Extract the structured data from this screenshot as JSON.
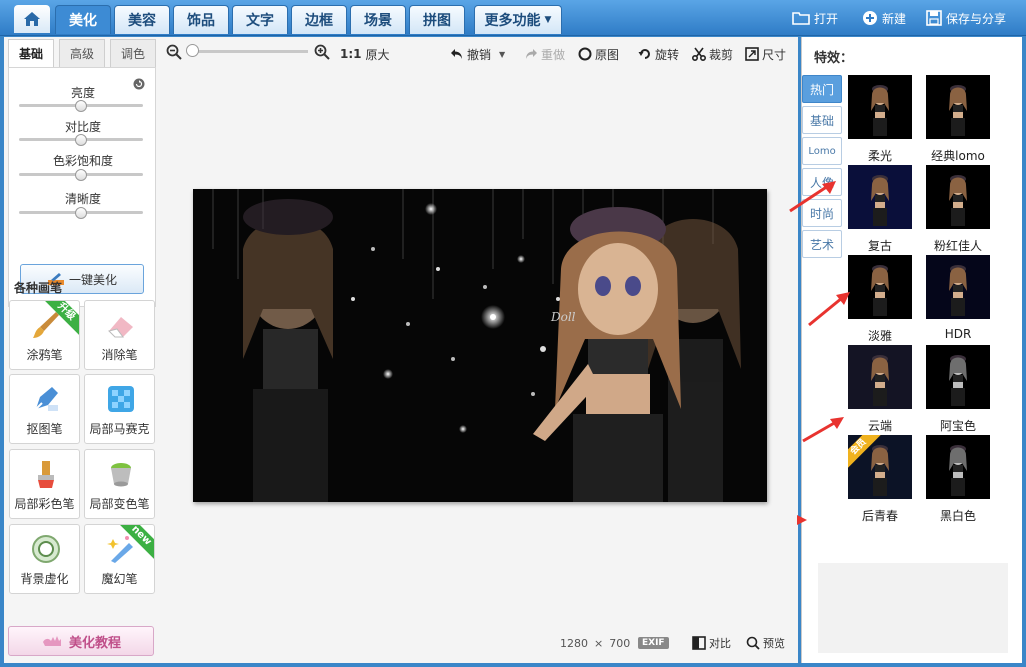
{
  "top": {
    "tabs": [
      "美化",
      "美容",
      "饰品",
      "文字",
      "边框",
      "场景",
      "拼图",
      "更多功能"
    ],
    "active_tab": "美化",
    "actions": {
      "open": "打开",
      "new": "新建",
      "save": "保存与分享"
    }
  },
  "left": {
    "tabs": [
      "基础",
      "高级",
      "调色"
    ],
    "active_tab": "基础",
    "sliders": [
      {
        "label": "亮度",
        "value": 0.5
      },
      {
        "label": "对比度",
        "value": 0.5
      },
      {
        "label": "色彩饱和度",
        "value": 0.5
      },
      {
        "label": "清晰度",
        "value": 0.5
      }
    ],
    "one_key": "一键美化",
    "brush_title": "各种画笔",
    "brushes": [
      {
        "label": "涂鸦笔",
        "icon": "paintbrush-icon",
        "badge": "升级"
      },
      {
        "label": "消除笔",
        "icon": "eraser-icon",
        "badge": ""
      },
      {
        "label": "抠图笔",
        "icon": "pen-cutout-icon",
        "badge": ""
      },
      {
        "label": "局部马赛克",
        "icon": "mosaic-icon",
        "badge": ""
      },
      {
        "label": "局部彩色笔",
        "icon": "color-brush-icon",
        "badge": ""
      },
      {
        "label": "局部变色笔",
        "icon": "paint-bucket-icon",
        "badge": ""
      },
      {
        "label": "背景虚化",
        "icon": "blur-icon",
        "badge": ""
      },
      {
        "label": "魔幻笔",
        "icon": "magic-pen-icon",
        "badge": "new"
      }
    ],
    "tutorial": "美化教程"
  },
  "toolbar": {
    "zoom_ratio": "1:1",
    "original_size": "原大",
    "undo": "撤销",
    "redo": "重做",
    "original": "原图",
    "rotate": "旋转",
    "crop": "裁剪",
    "size": "尺寸"
  },
  "status": {
    "width": "1280",
    "times": "×",
    "height": "700",
    "exif": "EXIF",
    "compare": "对比",
    "preview": "预览"
  },
  "right": {
    "title": "特效：",
    "categories": [
      "热门",
      "基础",
      "Lomo",
      "人像",
      "时尚",
      "艺术"
    ],
    "active_category": "热门",
    "effects": [
      {
        "label": "柔光",
        "tint": "#000000"
      },
      {
        "label": "经典lomo",
        "tint": "#000000"
      },
      {
        "label": "复古",
        "tint": "#0a0f3a"
      },
      {
        "label": "粉红佳人",
        "tint": "#000000"
      },
      {
        "label": "淡雅",
        "tint": "#000000"
      },
      {
        "label": "HDR",
        "tint": "#05061a"
      },
      {
        "label": "云端",
        "tint": "#141424"
      },
      {
        "label": "阿宝色",
        "tint": "#000000"
      },
      {
        "label": "后青春",
        "tint": "#0c1326",
        "badge": "会员"
      },
      {
        "label": "黑白色",
        "tint": "#000000"
      }
    ]
  },
  "photo": {
    "watermark": "Doll"
  }
}
